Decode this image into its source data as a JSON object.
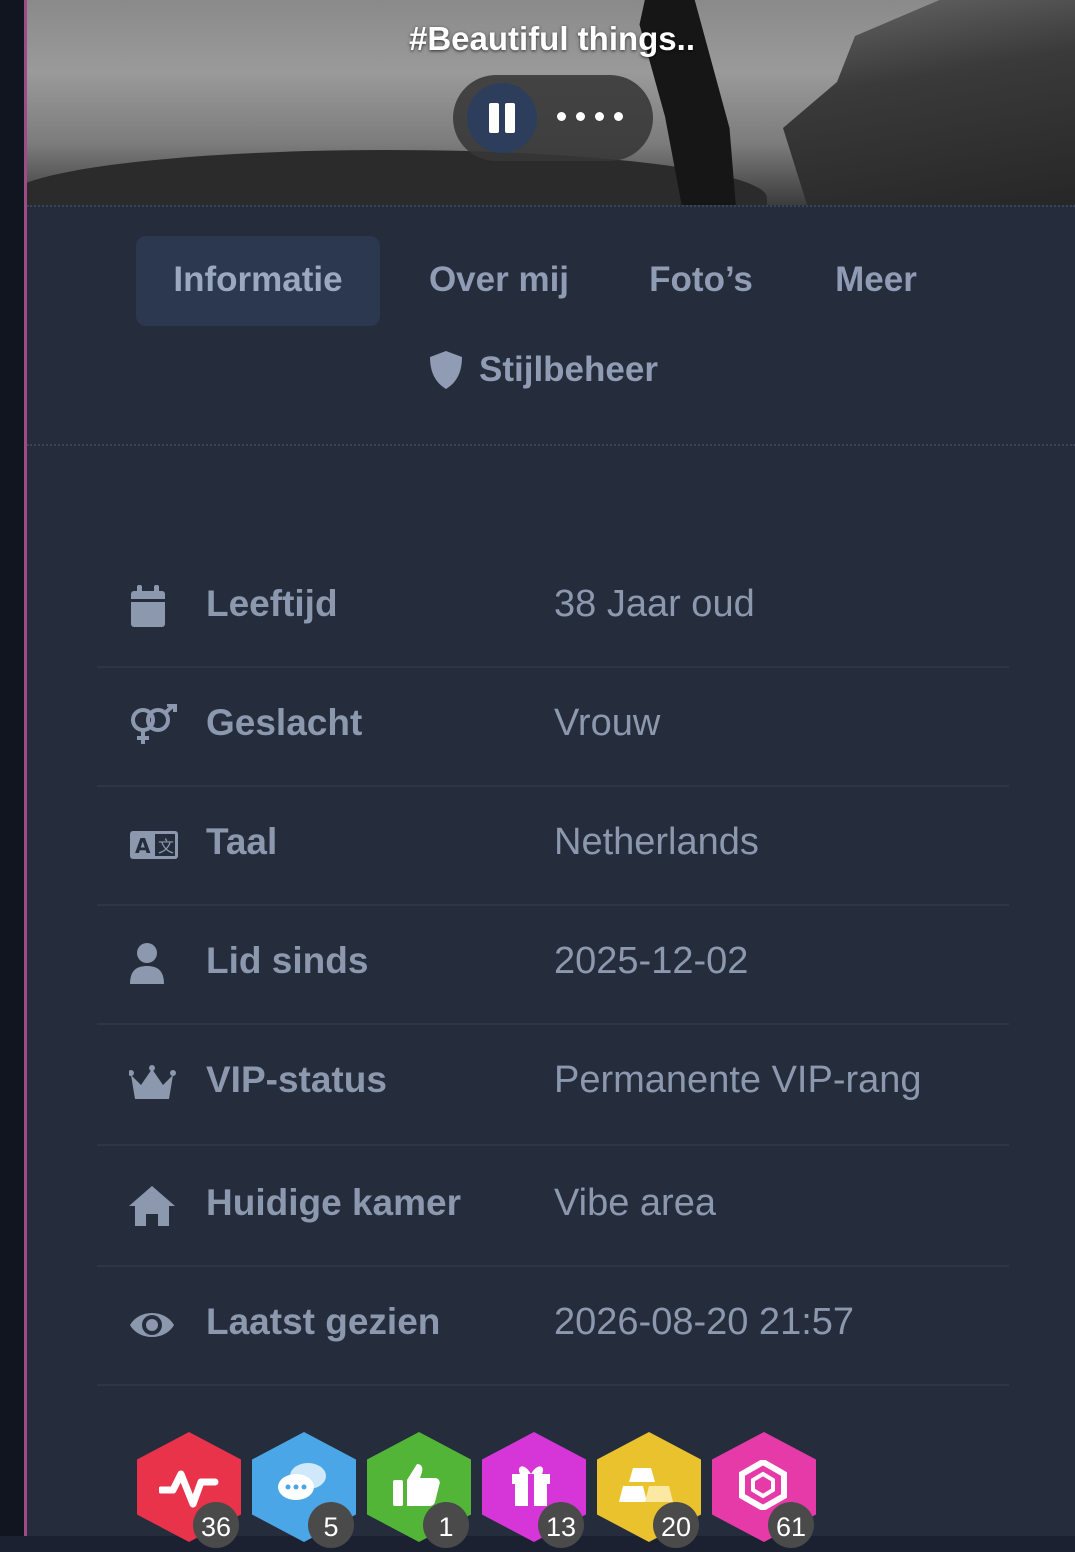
{
  "profile": {
    "motto": "#Beautiful things.."
  },
  "tabs": [
    {
      "label": "Informatie",
      "active": true
    },
    {
      "label": "Over mij",
      "active": false
    },
    {
      "label": "Foto’s",
      "active": false
    },
    {
      "label": "Meer",
      "active": false
    }
  ],
  "style_tab": {
    "label": "Stijlbeheer",
    "icon": "shield-icon"
  },
  "info": [
    {
      "label": "Leeftijd",
      "value": "38 Jaar oud",
      "icon": "calendar-icon"
    },
    {
      "label": "Geslacht",
      "value": "Vrouw",
      "icon": "gender-icon"
    },
    {
      "label": "Taal",
      "value": "Netherlands",
      "icon": "language-icon"
    },
    {
      "label": "Lid sinds",
      "value": "2025-12-02",
      "icon": "user-icon"
    },
    {
      "label": "VIP-status",
      "value": "Permanente VIP-rang",
      "icon": "crown-icon"
    },
    {
      "label": "Huidige kamer",
      "value": "Vibe area",
      "icon": "home-icon"
    },
    {
      "label": "Laatst gezien",
      "value": "2026-08-20 21:57",
      "icon": "eye-icon"
    }
  ],
  "badges": [
    {
      "icon": "activity-icon",
      "count": "36",
      "color": "#e8334a"
    },
    {
      "icon": "chat-icon",
      "count": "5",
      "color": "#4aa6e6"
    },
    {
      "icon": "thumbs-up-icon",
      "count": "1",
      "color": "#53b537"
    },
    {
      "icon": "gift-icon",
      "count": "13",
      "color": "#d636d8"
    },
    {
      "icon": "gold-bars-icon",
      "count": "20",
      "color": "#eac22d"
    },
    {
      "icon": "gem-icon",
      "count": "61",
      "color": "#e63aa8"
    }
  ]
}
